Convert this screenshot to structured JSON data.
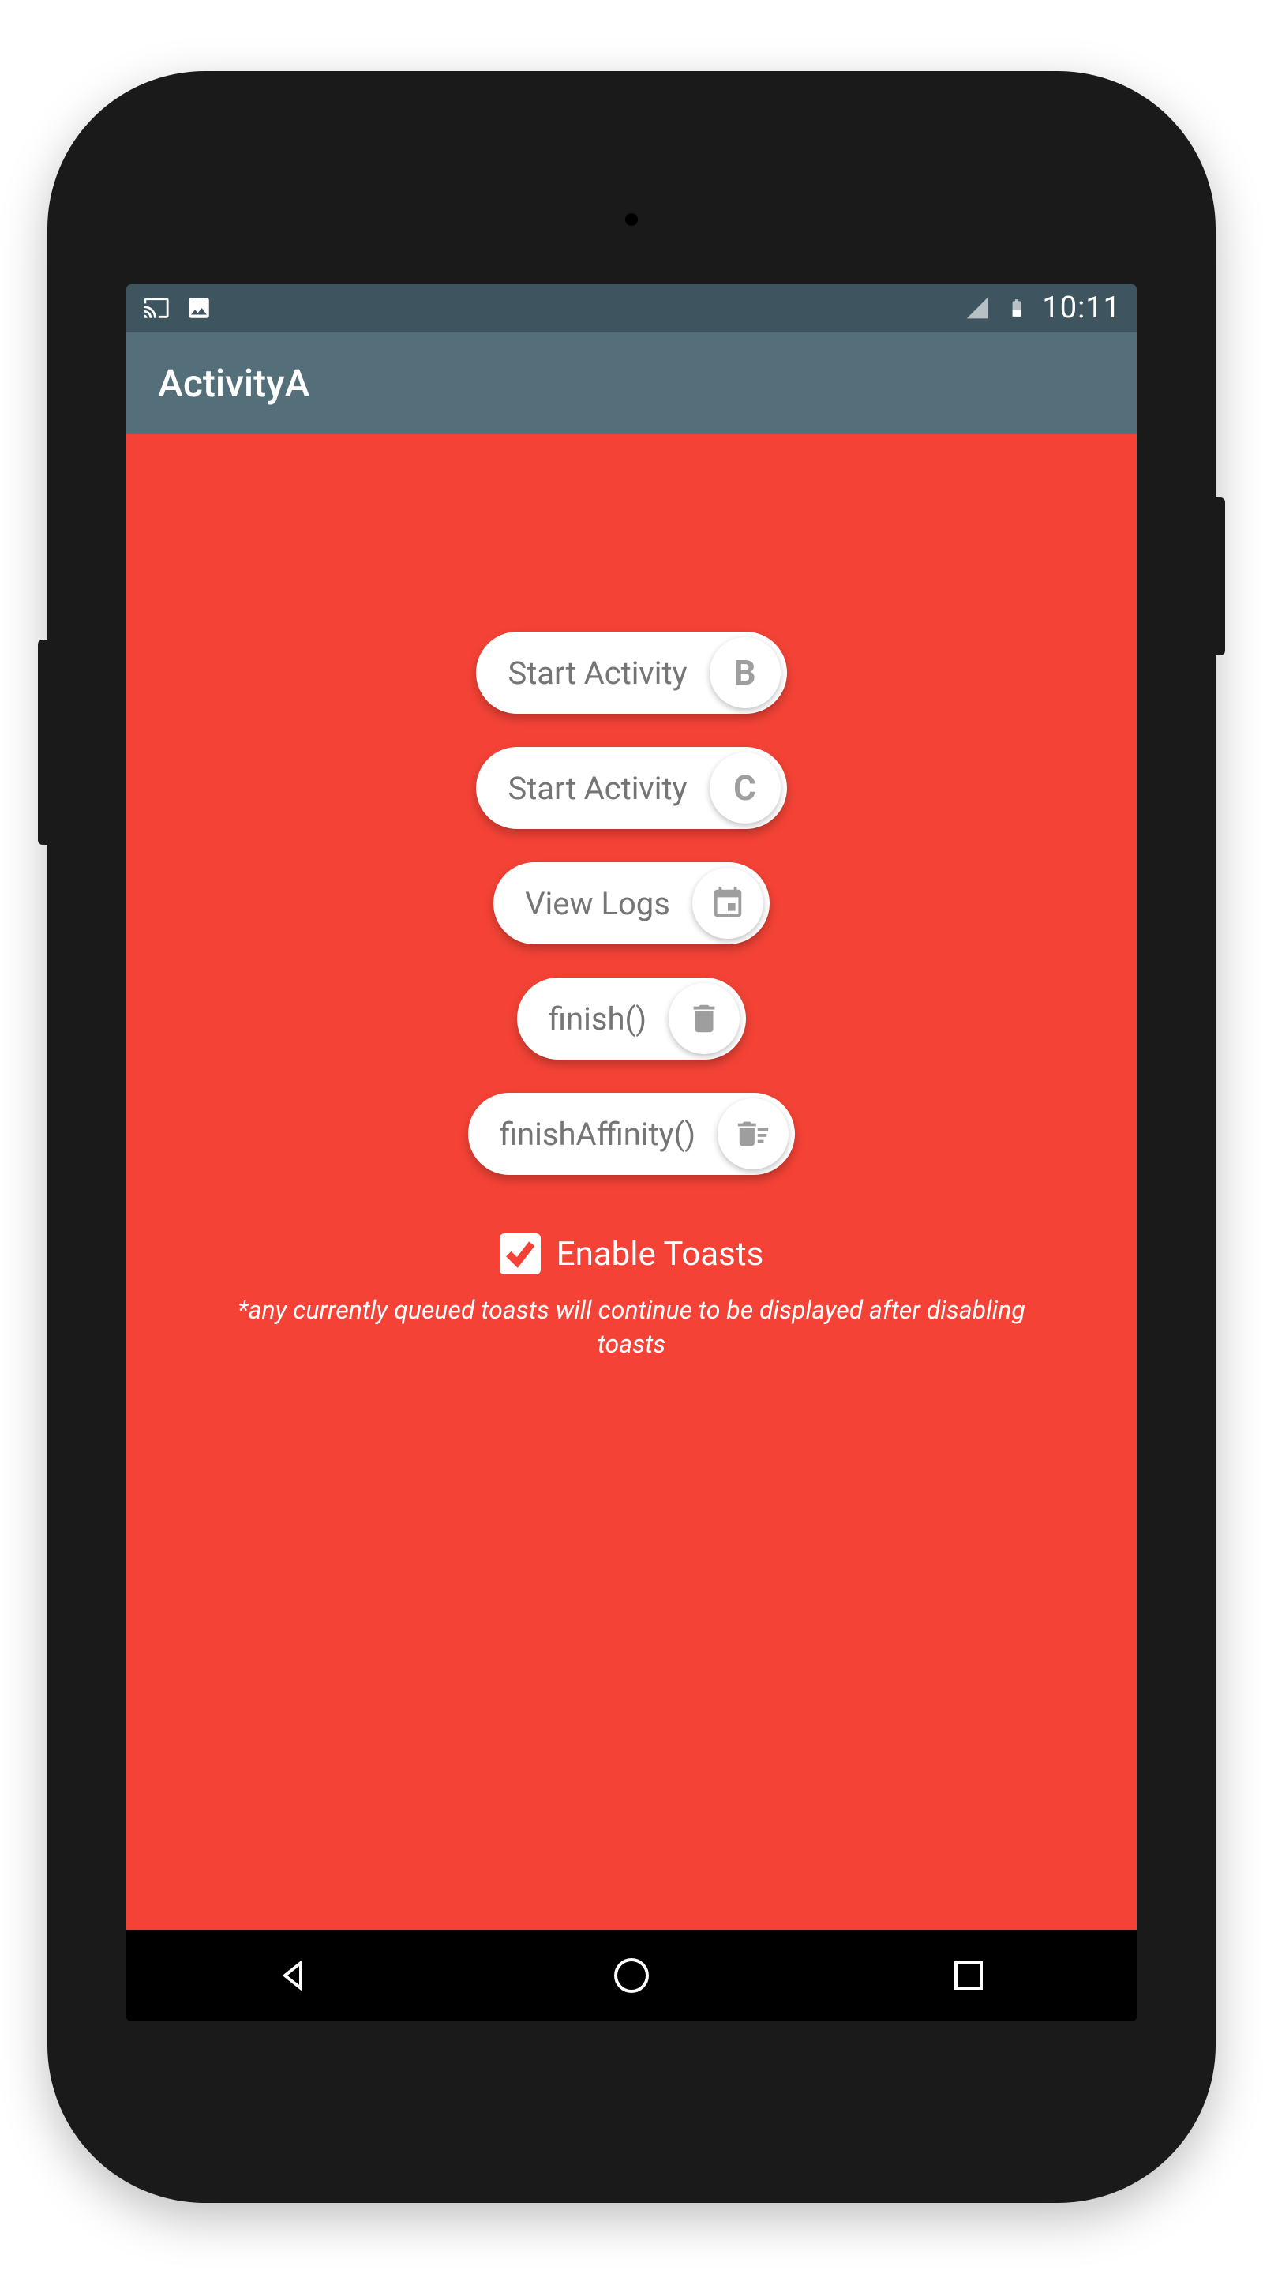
{
  "statusbar": {
    "time": "10:11",
    "battery": "39"
  },
  "appbar": {
    "title": "ActivityA"
  },
  "buttons": {
    "startB": {
      "label": "Start Activity",
      "chip": "B"
    },
    "startC": {
      "label": "Start Activity",
      "chip": "C"
    },
    "viewLogs": {
      "label": "View Logs"
    },
    "finish": {
      "label": "finish()"
    },
    "finishAffinity": {
      "label": "finishAffinity()"
    }
  },
  "toasts": {
    "enabled": true,
    "label": "Enable Toasts",
    "note": "*any currently queued toasts will continue to be displayed after disabling toasts"
  },
  "colors": {
    "accent": "#f44336",
    "appbar": "#546e7a",
    "statusbar": "#3e5560",
    "buttonText": "#757575",
    "iconGray": "#9e9e9e"
  }
}
